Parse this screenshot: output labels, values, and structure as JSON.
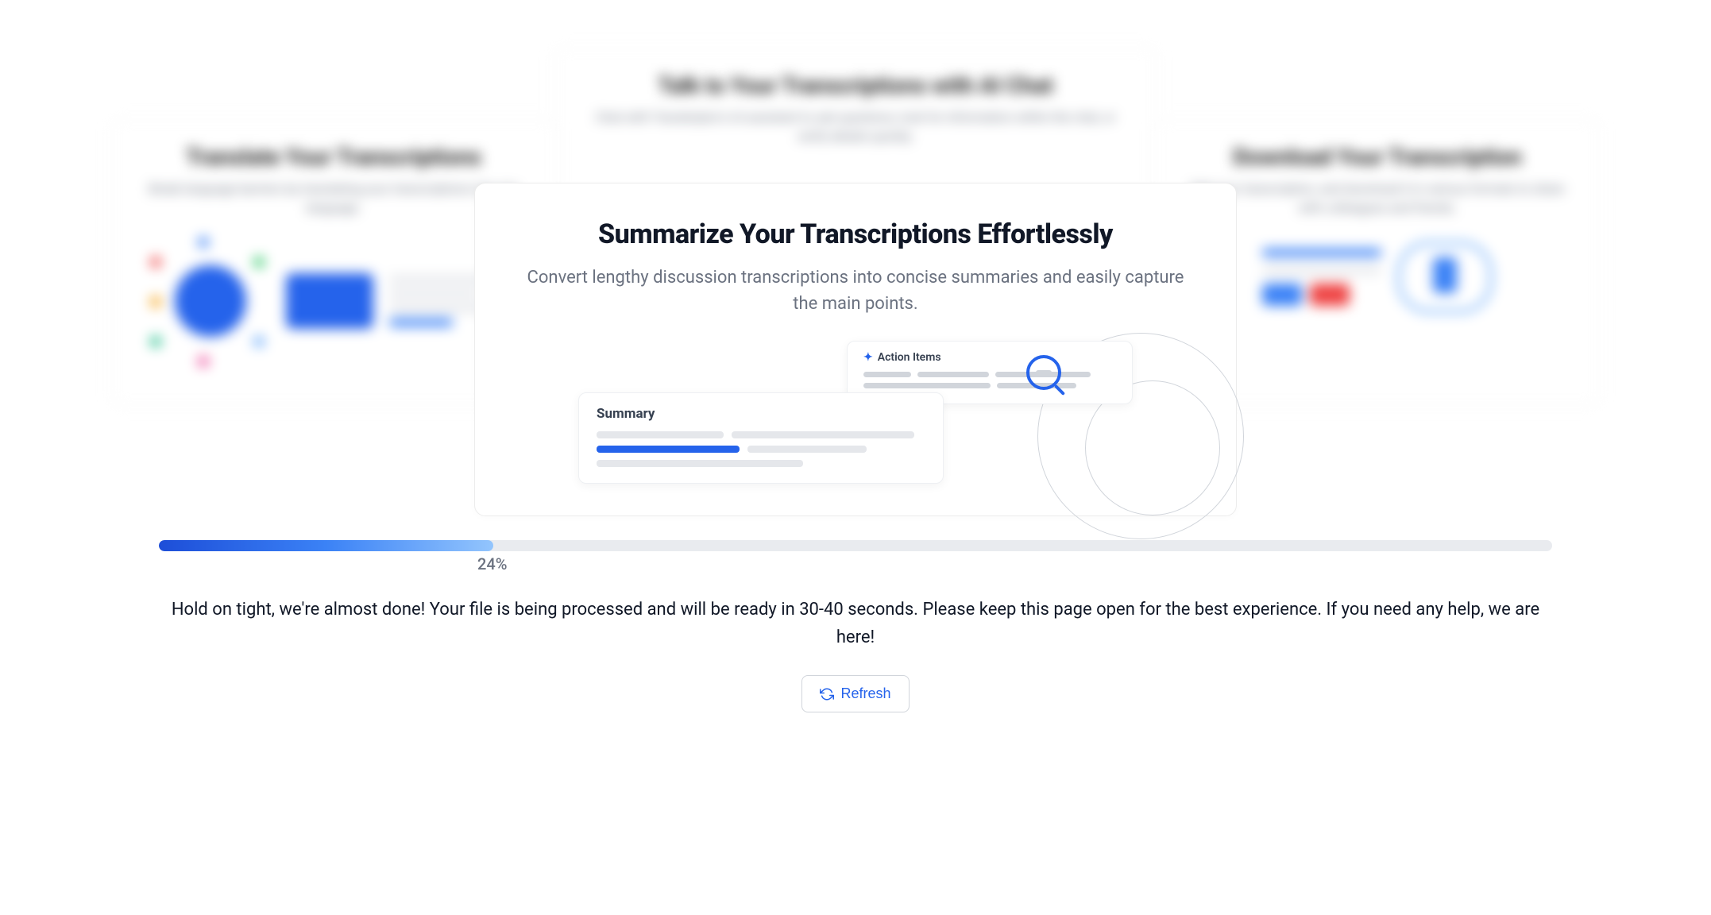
{
  "carousel": {
    "blurred_top": {
      "title": "Talk to Your Transcriptions with AI Chat",
      "description": "Chat with Transkriptor's AI assistant to ask questions, look for information within the chat, or verify details quickly."
    },
    "blurred_left": {
      "title": "Translate Your Transcriptions",
      "description": "Break language barriers by translating your transcriptions into any language."
    },
    "blurred_right": {
      "title": "Download Your Transcription",
      "description": "Edit your transcription, and download it in various formats to share with colleagues and friends."
    },
    "main": {
      "title": "Summarize Your Transcriptions Effortlessly",
      "description": "Convert lengthy discussion transcriptions into concise summaries and easily capture the main points.",
      "summary_label": "Summary",
      "action_label": "Action Items"
    }
  },
  "progress": {
    "percent_value": 24,
    "percent_label": "24%",
    "message": "Hold on tight, we're almost done! Your file is being processed and will be ready in 30-40 seconds. Please keep this page open for the best experience. If you need any help, we are here!",
    "refresh_label": "Refresh"
  }
}
